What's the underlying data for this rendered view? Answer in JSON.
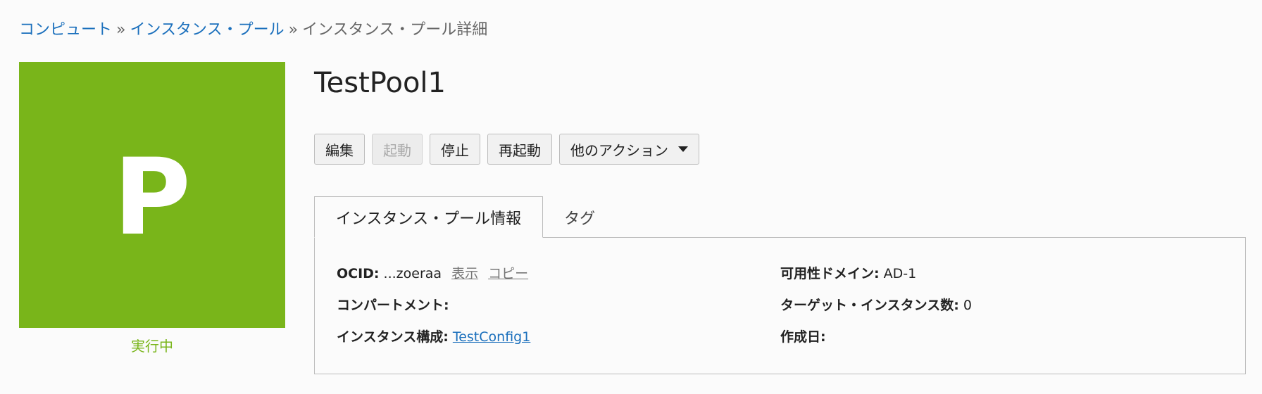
{
  "breadcrumb": {
    "items": [
      "コンピュート",
      "インスタンス・プール"
    ],
    "separator": "»",
    "current": "インスタンス・プール詳細"
  },
  "tile": {
    "letter": "P",
    "color": "#79b51a",
    "status": "実行中"
  },
  "title": "TestPool1",
  "actions": {
    "edit": "編集",
    "start": "起動",
    "stop": "停止",
    "reboot": "再起動",
    "more": "他のアクション"
  },
  "tabs": {
    "info": "インスタンス・プール情報",
    "tags": "タグ"
  },
  "info": {
    "ocid_label": "OCID:",
    "ocid_value": "...zoeraa",
    "ocid_show": "表示",
    "ocid_copy": "コピー",
    "compartment_label": "コンパートメント:",
    "compartment_value": "",
    "instance_config_label": "インスタンス構成:",
    "instance_config_value": "TestConfig1",
    "ad_label": "可用性ドメイン:",
    "ad_value": "AD-1",
    "target_label": "ターゲット・インスタンス数:",
    "target_value": "0",
    "created_label": "作成日:",
    "created_value": ""
  },
  "colors": {
    "link": "#1a6fbc",
    "running": "#79b51a"
  }
}
